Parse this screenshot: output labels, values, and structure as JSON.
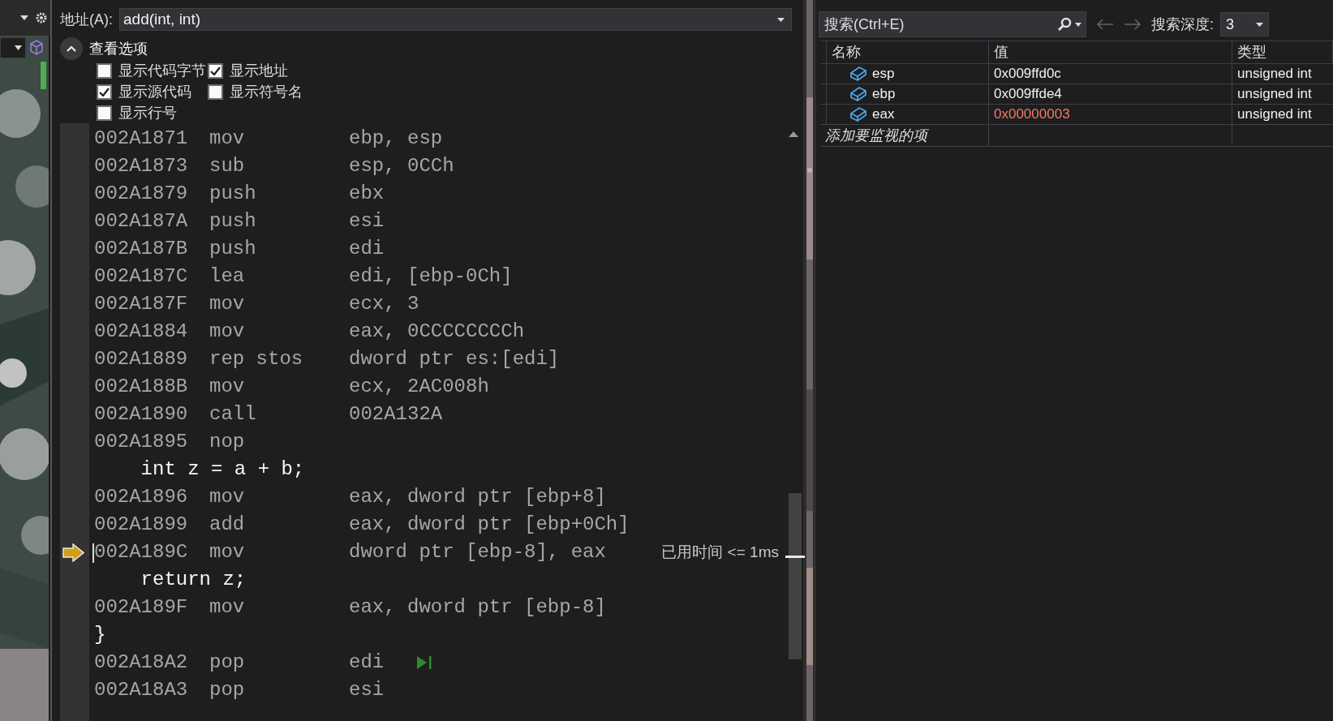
{
  "disassembly": {
    "address_label": "地址(A):",
    "address_value": "add(int, int)",
    "options_title": "查看选项",
    "options_expanded": true,
    "options": [
      {
        "label": "显示代码字节",
        "checked": false
      },
      {
        "label": "显示地址",
        "checked": true
      },
      {
        "label": "显示源代码",
        "checked": true
      },
      {
        "label": "显示符号名",
        "checked": false
      },
      {
        "label": "显示行号",
        "checked": false
      }
    ],
    "lines": [
      {
        "kind": "asm",
        "address": "002A1871",
        "mnemonic": "mov",
        "operands": "ebp, esp"
      },
      {
        "kind": "asm",
        "address": "002A1873",
        "mnemonic": "sub",
        "operands": "esp, 0CCh"
      },
      {
        "kind": "asm",
        "address": "002A1879",
        "mnemonic": "push",
        "operands": "ebx"
      },
      {
        "kind": "asm",
        "address": "002A187A",
        "mnemonic": "push",
        "operands": "esi"
      },
      {
        "kind": "asm",
        "address": "002A187B",
        "mnemonic": "push",
        "operands": "edi"
      },
      {
        "kind": "asm",
        "address": "002A187C",
        "mnemonic": "lea",
        "operands": "edi, [ebp-0Ch]"
      },
      {
        "kind": "asm",
        "address": "002A187F",
        "mnemonic": "mov",
        "operands": "ecx, 3"
      },
      {
        "kind": "asm",
        "address": "002A1884",
        "mnemonic": "mov",
        "operands": "eax, 0CCCCCCCCh"
      },
      {
        "kind": "asm",
        "address": "002A1889",
        "mnemonic": "rep stos",
        "operands": "dword ptr es:[edi]"
      },
      {
        "kind": "asm",
        "address": "002A188B",
        "mnemonic": "mov",
        "operands": "ecx, 2AC008h"
      },
      {
        "kind": "asm",
        "address": "002A1890",
        "mnemonic": "call",
        "operands": "002A132A"
      },
      {
        "kind": "asm",
        "address": "002A1895",
        "mnemonic": "nop"
      },
      {
        "kind": "source",
        "text": "    int z = a + b;"
      },
      {
        "kind": "asm",
        "address": "002A1896",
        "mnemonic": "mov",
        "operands": "eax, dword ptr [ebp+8]"
      },
      {
        "kind": "asm",
        "address": "002A1899",
        "mnemonic": "add",
        "operands": "eax, dword ptr [ebp+0Ch]"
      },
      {
        "kind": "asm",
        "address": "002A189C",
        "mnemonic": "mov",
        "operands": "dword ptr [ebp-8], eax",
        "current": true,
        "elapsed": "已用时间 <= 1ms"
      },
      {
        "kind": "source",
        "text": "    return z;"
      },
      {
        "kind": "asm",
        "address": "002A189F",
        "mnemonic": "mov",
        "operands": "eax, dword ptr [ebp-8]"
      },
      {
        "kind": "source",
        "text": "}"
      },
      {
        "kind": "asm",
        "address": "002A18A2",
        "mnemonic": "pop",
        "operands": "edi",
        "run_to": true
      },
      {
        "kind": "asm",
        "address": "002A18A3",
        "mnemonic": "pop",
        "operands": "esi"
      }
    ]
  },
  "watch": {
    "search_placeholder": "搜索(Ctrl+E)",
    "depth_label": "搜索深度:",
    "depth_value": "3",
    "columns": [
      "名称",
      "值",
      "类型"
    ],
    "rows": [
      {
        "name": "esp",
        "value": "0x009ffd0c",
        "type": "unsigned int",
        "changed": false
      },
      {
        "name": "ebp",
        "value": "0x009ffde4",
        "type": "unsigned int",
        "changed": false
      },
      {
        "name": "eax",
        "value": "0x00000003",
        "type": "unsigned int",
        "changed": true
      }
    ],
    "add_item": "添加要监视的项"
  }
}
